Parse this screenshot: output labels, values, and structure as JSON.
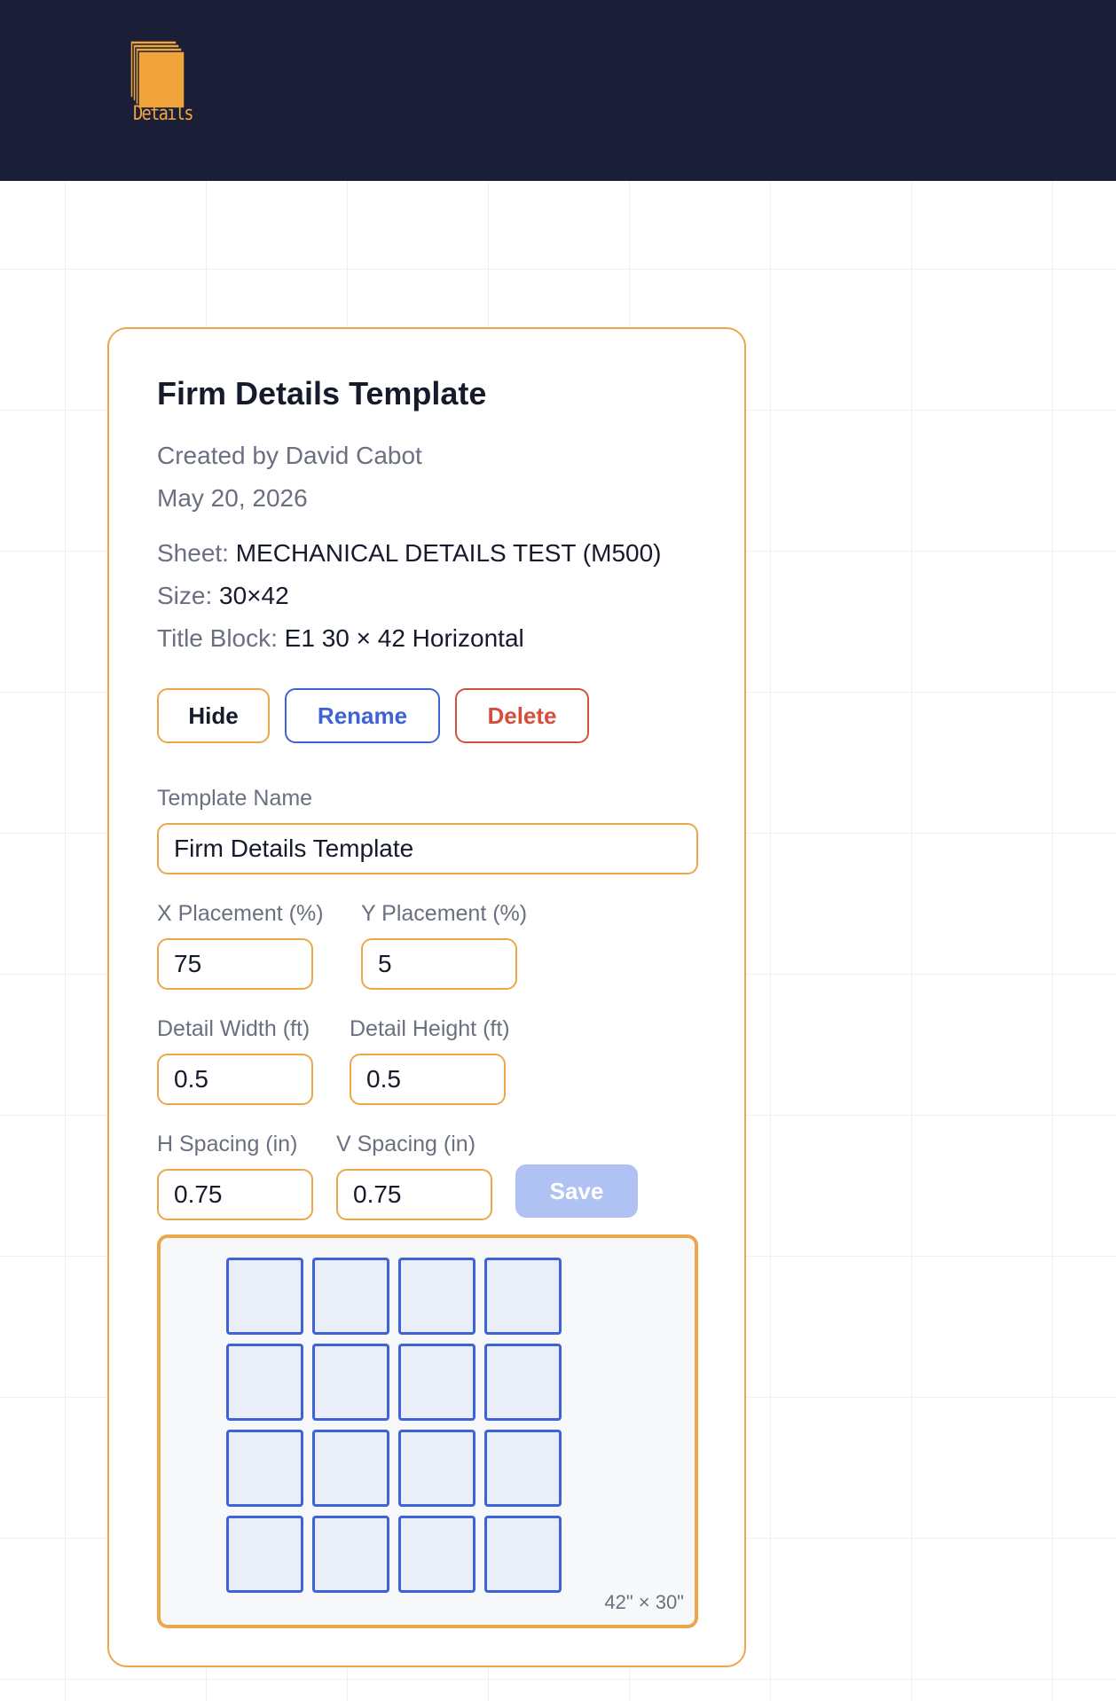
{
  "header": {
    "logo_text": "Details",
    "logo_color": "#f2a43c",
    "background": "#1a1f37"
  },
  "card": {
    "title": "Firm Details Template",
    "created_by": "Created by David Cabot",
    "date": "May 20, 2026",
    "sheet_label": "Sheet:",
    "sheet_value": "MECHANICAL DETAILS TEST (M500)",
    "size_label": "Size:",
    "size_value": "30×42",
    "title_block_label": "Title Block:",
    "title_block_value": "E1 30 × 42 Horizontal",
    "buttons": {
      "hide": "Hide",
      "rename": "Rename",
      "delete": "Delete",
      "save": "Save"
    },
    "fields": {
      "template_name_label": "Template Name",
      "template_name_value": "Firm Details Template",
      "x_placement_label": "X Placement (%)",
      "x_placement_value": "75",
      "y_placement_label": "Y Placement (%)",
      "y_placement_value": "5",
      "detail_width_label": "Detail Width (ft)",
      "detail_width_value": "0.5",
      "detail_height_label": "Detail Height (ft)",
      "detail_height_value": "0.5",
      "h_spacing_label": "H Spacing (in)",
      "h_spacing_value": "0.75",
      "v_spacing_label": "V Spacing (in)",
      "v_spacing_value": "0.75"
    },
    "preview": {
      "rows": 4,
      "columns": 4,
      "dimensions": "42\" × 30\""
    }
  },
  "colors": {
    "accent": "#eba74b",
    "primary": "#3d63d6",
    "danger": "#d5503c",
    "save_disabled": "#b0c2f3"
  }
}
